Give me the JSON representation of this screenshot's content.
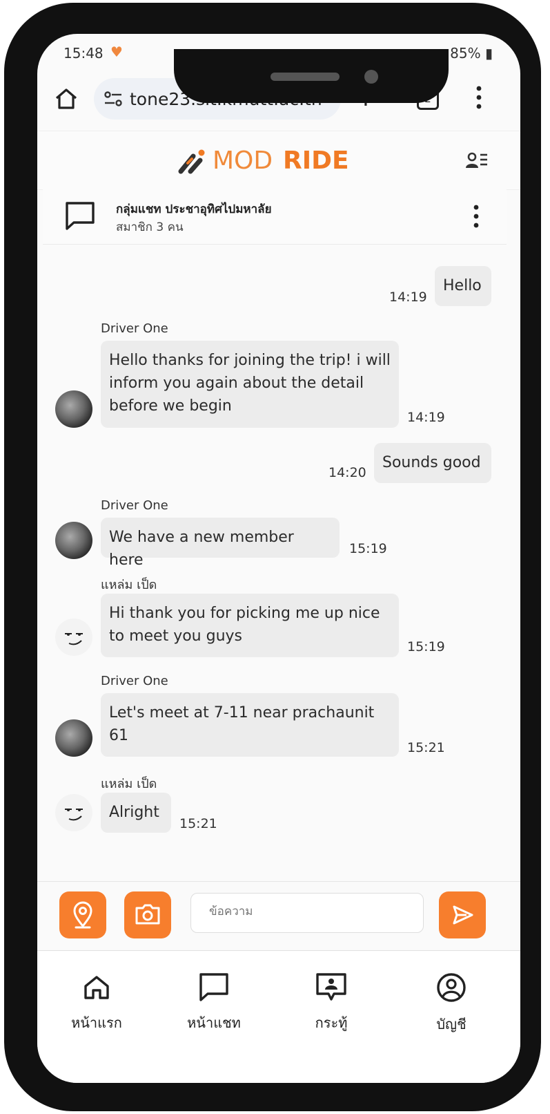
{
  "status_bar": {
    "time": "15:48",
    "battery": "85%"
  },
  "browser": {
    "url": "tone23.sit.kmutt.ac.th",
    "tab_count": "2"
  },
  "app": {
    "logo_part1": "MOD",
    "logo_part2": "RIDE",
    "accent_color": "#f77e2d"
  },
  "group": {
    "name": "กลุ่มแชท ประชาอุทิศไปมหาลัย",
    "members": "สมาชิก 3 คน"
  },
  "messages": [
    {
      "sender": "",
      "text": "Hello",
      "time": "14:19",
      "own": true
    },
    {
      "sender": "Driver One",
      "text": "Hello thanks for joining the trip! i will inform you again about the detail before we begin",
      "time": "14:19",
      "own": false
    },
    {
      "sender": "",
      "text": "Sounds good",
      "time": "14:20",
      "own": true
    },
    {
      "sender": "Driver One",
      "text": "We have a new member here",
      "time": "15:19",
      "own": false
    },
    {
      "sender": "แหล่ม เป็ด",
      "text": "Hi thank you for picking me up nice to meet you guys",
      "time": "15:19",
      "own": false
    },
    {
      "sender": "Driver One",
      "text": "Let's meet at 7-11 near prachaunit 61",
      "time": "15:21",
      "own": false
    },
    {
      "sender": "แหล่ม เป็ด",
      "text": "Alright",
      "time": "15:21",
      "own": false
    }
  ],
  "composer": {
    "placeholder": "ข้อความ"
  },
  "nav": [
    {
      "label": "หน้าแรก",
      "icon": "home-icon"
    },
    {
      "label": "หน้าแชท",
      "icon": "chat-icon"
    },
    {
      "label": "กระทู้",
      "icon": "board-icon"
    },
    {
      "label": "บัญชี",
      "icon": "account-icon"
    }
  ]
}
